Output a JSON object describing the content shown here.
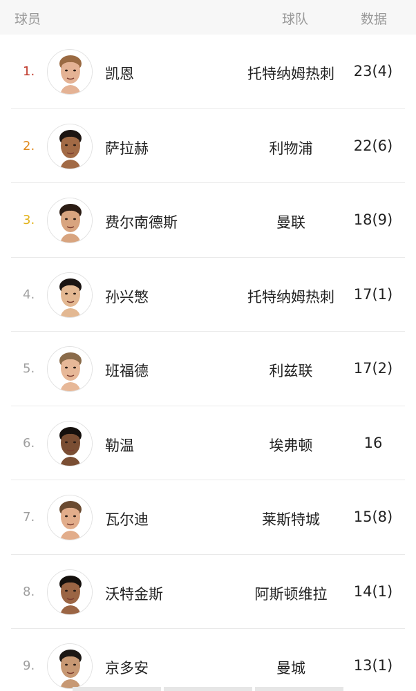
{
  "header": {
    "player_label": "球员",
    "team_label": "球队",
    "data_label": "数据"
  },
  "rows": [
    {
      "rank": "1.",
      "name": "凯恩",
      "team": "托特纳姆热刺",
      "stat": "23(4)",
      "skin": "#e4b294",
      "hair": "#9a6a42"
    },
    {
      "rank": "2.",
      "name": "萨拉赫",
      "team": "利物浦",
      "stat": "22(6)",
      "skin": "#a26a45",
      "hair": "#1d1512"
    },
    {
      "rank": "3.",
      "name": "费尔南德斯",
      "team": "曼联",
      "stat": "18(9)",
      "skin": "#d8a47f",
      "hair": "#2b1c14"
    },
    {
      "rank": "4.",
      "name": "孙兴慜",
      "team": "托特纳姆热刺",
      "stat": "17(1)",
      "skin": "#e3b892",
      "hair": "#1a1412"
    },
    {
      "rank": "5.",
      "name": "班福德",
      "team": "利兹联",
      "stat": "17(2)",
      "skin": "#e7b898",
      "hair": "#8a6b4a"
    },
    {
      "rank": "6.",
      "name": "勒温",
      "team": "埃弗顿",
      "stat": "16",
      "skin": "#7a4e33",
      "hair": "#15100d"
    },
    {
      "rank": "7.",
      "name": "瓦尔迪",
      "team": "莱斯特城",
      "stat": "15(8)",
      "skin": "#e2ad8b",
      "hair": "#6a4a30"
    },
    {
      "rank": "8.",
      "name": "沃特金斯",
      "team": "阿斯顿维拉",
      "stat": "14(1)",
      "skin": "#9b6544",
      "hair": "#14100d"
    },
    {
      "rank": "9.",
      "name": "京多安",
      "team": "曼城",
      "stat": "13(1)",
      "skin": "#c79873",
      "hair": "#1b1714"
    }
  ]
}
